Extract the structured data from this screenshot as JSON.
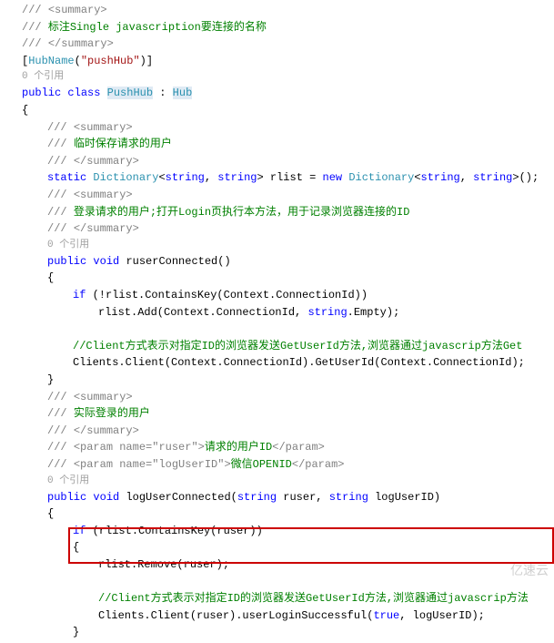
{
  "code": {
    "l1a": "/// ",
    "l1b": "<summary>",
    "l2a": "/// ",
    "l2b": "标注Single javascription要连接的名称",
    "l3a": "/// ",
    "l3b": "</summary>",
    "l4open": "[",
    "l4attr": "HubName",
    "l4paren": "(",
    "l4str": "\"pushHub\"",
    "l4close": ")]",
    "l5refs": "0 个引用",
    "l6pub": "public",
    "l6sp1": " ",
    "l6class": "class",
    "l6sp2": " ",
    "l6name": "PushHub",
    "l6sp3": " : ",
    "l6base": "Hub",
    "l7": "{",
    "l8a": "/// ",
    "l8b": "<summary>",
    "l9a": "/// ",
    "l9b": "临时保存请求的用户",
    "l10a": "/// ",
    "l10b": "</summary>",
    "l11static": "static",
    "l11sp1": " ",
    "l11dict1": "Dictionary",
    "l11g1": "<",
    "l11str1": "string",
    "l11comma1": ", ",
    "l11str2": "string",
    "l11g2": "> rlist = ",
    "l11new": "new",
    "l11sp2": " ",
    "l11dict2": "Dictionary",
    "l11g3": "<",
    "l11str3": "string",
    "l11comma2": ", ",
    "l11str4": "string",
    "l11g4": ">();",
    "l12": "",
    "l13a": "/// ",
    "l13b": "<summary>",
    "l14a": "/// ",
    "l14b": "登录请求的用户;打开Login页执行本方法，用于记录浏览器连接的ID",
    "l15a": "/// ",
    "l15b": "</summary>",
    "l16refs": "0 个引用",
    "l17pub": "public",
    "l17sp1": " ",
    "l17void": "void",
    "l17sp2": " ",
    "l17name": "ruserConnected()",
    "l18": "{",
    "l19if": "if",
    "l19cond": " (!rlist.ContainsKey(Context.ConnectionId))",
    "l20a": "rlist.Add(Context.ConnectionId, ",
    "l20str": "string",
    "l20b": ".Empty);",
    "l21": "",
    "l22": "//Client方式表示对指定ID的浏览器发送GetUserId方法,浏览器通过javascrip方法Get",
    "l23": "Clients.Client(Context.ConnectionId).GetUserId(Context.ConnectionId);",
    "l24": "}",
    "l25a": "/// ",
    "l25b": "<summary>",
    "l26a": "/// ",
    "l26b": "实际登录的用户",
    "l27a": "/// ",
    "l27b": "</summary>",
    "l28a": "/// ",
    "l28b": "<param name=\"",
    "l28c": "ruser",
    "l28d": "\">",
    "l28e": "请求的用户ID",
    "l28f": "</param>",
    "l29a": "/// ",
    "l29b": "<param name=\"",
    "l29c": "logUserID",
    "l29d": "\">",
    "l29e": "微信OPENID",
    "l29f": "</param>",
    "l30refs": "0 个引用",
    "l31pub": "public",
    "l31sp1": " ",
    "l31void": "void",
    "l31sp2": " ",
    "l31name": "logUserConnected(",
    "l31str1": "string",
    "l31p1": " ruser, ",
    "l31str2": "string",
    "l31p2": " logUserID)",
    "l32": "{",
    "l33if": "if",
    "l33cond": " (rlist.ContainsKey(ruser))",
    "l34": "{",
    "l35": "rlist.Remove(ruser);",
    "l36": "",
    "l37": "//Client方式表示对指定ID的浏览器发送GetUserId方法,浏览器通过javascrip方法",
    "l38a": "Clients.Client(ruser).userLoginSuccessful(",
    "l38true": "true",
    "l38b": ", logUserID);",
    "l39": "}"
  },
  "watermark": "亿速云"
}
